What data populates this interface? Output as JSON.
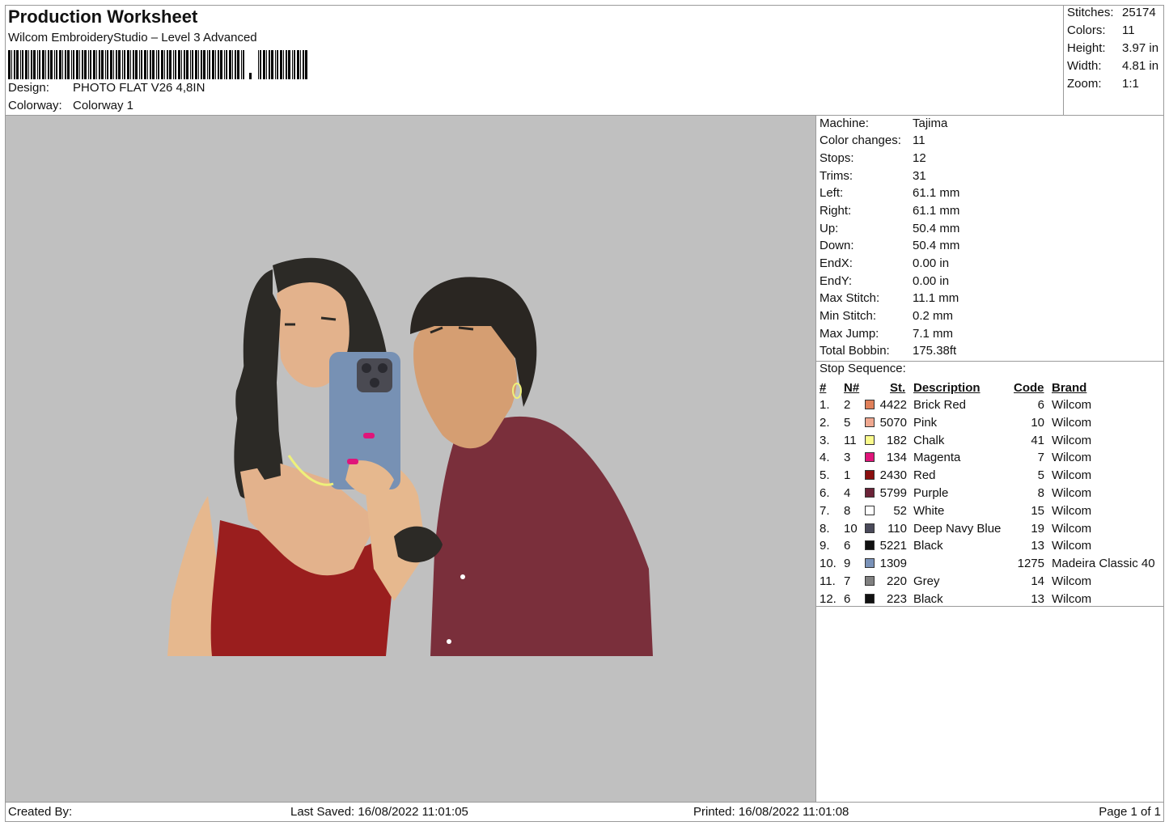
{
  "header": {
    "title": "Production Worksheet",
    "subtitle": "Wilcom EmbroideryStudio – Level 3 Advanced",
    "design_label": "Design:",
    "design_value": "PHOTO FLAT V26 4,8IN",
    "colorway_label": "Colorway:",
    "colorway_value": "Colorway 1"
  },
  "summary": [
    {
      "label": "Stitches:",
      "value": "25174"
    },
    {
      "label": "Colors:",
      "value": "11"
    },
    {
      "label": "Height:",
      "value": "3.97 in"
    },
    {
      "label": "Width:",
      "value": "4.81 in"
    },
    {
      "label": "Zoom:",
      "value": "1:1"
    }
  ],
  "machine_info": [
    {
      "label": "Machine:",
      "value": "Tajima"
    },
    {
      "label": "Color changes:",
      "value": "11"
    },
    {
      "label": "Stops:",
      "value": "12"
    },
    {
      "label": "Trims:",
      "value": "31"
    },
    {
      "label": "Left:",
      "value": "61.1 mm"
    },
    {
      "label": "Right:",
      "value": "61.1 mm"
    },
    {
      "label": "Up:",
      "value": "50.4 mm"
    },
    {
      "label": "Down:",
      "value": "50.4 mm"
    },
    {
      "label": "EndX:",
      "value": "0.00 in"
    },
    {
      "label": "EndY:",
      "value": "0.00 in"
    },
    {
      "label": "Max Stitch:",
      "value": "11.1 mm"
    },
    {
      "label": "Min Stitch:",
      "value": "0.2 mm"
    },
    {
      "label": "Max Jump:",
      "value": "7.1 mm"
    },
    {
      "label": "Total Bobbin:",
      "value": "175.38ft"
    }
  ],
  "stop_sequence": {
    "title": "Stop Sequence:",
    "headers": {
      "idx": "#",
      "n": "N#",
      "st": "St.",
      "desc": "Description",
      "code": "Code",
      "brand": "Brand"
    },
    "rows": [
      {
        "idx": "1.",
        "n": "2",
        "color": "#e0805a",
        "st": "4422",
        "desc": "Brick Red",
        "code": "6",
        "brand": "Wilcom"
      },
      {
        "idx": "2.",
        "n": "5",
        "color": "#f0a890",
        "st": "5070",
        "desc": "Pink",
        "code": "10",
        "brand": "Wilcom"
      },
      {
        "idx": "3.",
        "n": "11",
        "color": "#fbfb8c",
        "st": "182",
        "desc": "Chalk",
        "code": "41",
        "brand": "Wilcom"
      },
      {
        "idx": "4.",
        "n": "3",
        "color": "#e0157a",
        "st": "134",
        "desc": "Magenta",
        "code": "7",
        "brand": "Wilcom"
      },
      {
        "idx": "5.",
        "n": "1",
        "color": "#8a0f0f",
        "st": "2430",
        "desc": "Red",
        "code": "5",
        "brand": "Wilcom"
      },
      {
        "idx": "6.",
        "n": "4",
        "color": "#6b2338",
        "st": "5799",
        "desc": "Purple",
        "code": "8",
        "brand": "Wilcom"
      },
      {
        "idx": "7.",
        "n": "8",
        "color": "#ffffff",
        "st": "52",
        "desc": "White",
        "code": "15",
        "brand": "Wilcom"
      },
      {
        "idx": "8.",
        "n": "10",
        "color": "#4a4a5a",
        "st": "110",
        "desc": "Deep Navy Blue",
        "code": "19",
        "brand": "Wilcom"
      },
      {
        "idx": "9.",
        "n": "6",
        "color": "#111111",
        "st": "5221",
        "desc": "Black",
        "code": "13",
        "brand": "Wilcom"
      },
      {
        "idx": "10.",
        "n": "9",
        "color": "#7a92b8",
        "st": "1309",
        "desc": "",
        "code": "1275",
        "brand": "Madeira Classic 40"
      },
      {
        "idx": "11.",
        "n": "7",
        "color": "#808080",
        "st": "220",
        "desc": "Grey",
        "code": "14",
        "brand": "Wilcom"
      },
      {
        "idx": "12.",
        "n": "6",
        "color": "#111111",
        "st": "223",
        "desc": "Black",
        "code": "13",
        "brand": "Wilcom"
      }
    ]
  },
  "footer": {
    "created_by": "Created By:",
    "last_saved": "Last Saved: 16/08/2022 11:01:05",
    "printed": "Printed: 16/08/2022 11:01:08",
    "page": "Page 1 of 1"
  }
}
